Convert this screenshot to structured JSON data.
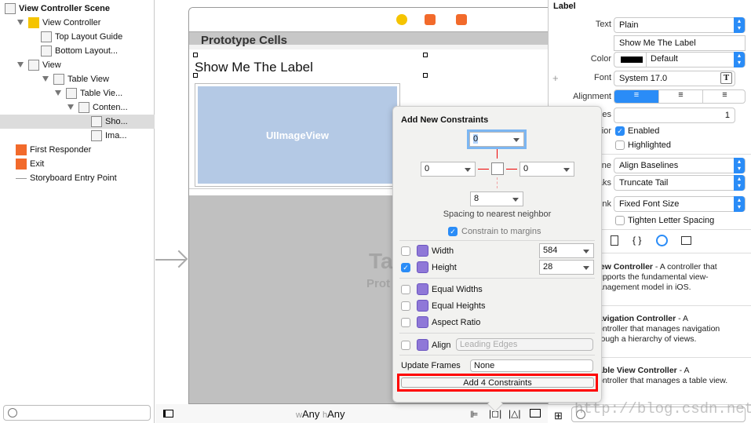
{
  "outline": {
    "items": [
      {
        "label": "View Controller Scene",
        "bold": true,
        "icon": "scene-icon"
      },
      {
        "label": "View Controller",
        "icon": "view-controller-icon"
      },
      {
        "label": "Top Layout Guide",
        "icon": "top-layout-guide-icon"
      },
      {
        "label": "Bottom Layout...",
        "icon": "bottom-layout-guide-icon"
      },
      {
        "label": "View",
        "icon": "view-icon"
      },
      {
        "label": "Table View",
        "icon": "table-view-icon"
      },
      {
        "label": "Table Vie...",
        "icon": "table-view-cell-icon"
      },
      {
        "label": "Conten...",
        "icon": "content-view-icon"
      },
      {
        "label": "Sho...",
        "icon": "label-icon",
        "selected": true
      },
      {
        "label": "Ima...",
        "icon": "image-view-icon"
      },
      {
        "label": "First Responder",
        "icon": "first-responder-icon"
      },
      {
        "label": "Exit",
        "icon": "exit-icon"
      },
      {
        "label": "Storyboard Entry Point",
        "icon": "arrow-right-icon"
      }
    ]
  },
  "canvas": {
    "prototype_cells": "Prototype Cells",
    "label_text": "Show Me The Label",
    "image_view": "UIImageView",
    "table_title_partial": "Ta",
    "table_sub_partial": "Prot",
    "size_w_prefix": "w",
    "size_w": "Any",
    "size_h_prefix": "h",
    "size_h": "Any"
  },
  "popover": {
    "title": "Add New Constraints",
    "top": "0",
    "left": "0",
    "right": "0",
    "bottom": "8",
    "spacing_label": "Spacing to nearest neighbor",
    "constrain_margins": "Constrain to margins",
    "width_label": "Width",
    "width_value": "584",
    "width_checked": false,
    "height_label": "Height",
    "height_value": "28",
    "height_checked": true,
    "equal_widths": "Equal Widths",
    "equal_heights": "Equal Heights",
    "aspect_ratio": "Aspect Ratio",
    "align_label": "Align",
    "align_value": "Leading Edges",
    "update_frames_label": "Update Frames",
    "update_frames_value": "None",
    "add_button": "Add 4 Constraints",
    "highlight_color": "#ff0000"
  },
  "inspector": {
    "section": "Label",
    "text_label": "Text",
    "text_value": "Plain",
    "text_content": "Show Me The Label",
    "color_label": "Color",
    "color_value": "Default",
    "font_label": "Font",
    "font_value": "System 17.0",
    "alignment_label": "Alignment",
    "lines_label": "es",
    "lines_value": "1",
    "behavior_label": "ior",
    "enabled": "Enabled",
    "highlighted": "Highlighted",
    "baseline_label": "ne",
    "baseline_value": "Align Baselines",
    "linebreaks_label": "aks",
    "linebreaks_value": "Truncate Tail",
    "autoshrink_label": "ink",
    "autoshrink_value": "Fixed Font Size",
    "tighten": "Tighten Letter Spacing",
    "library": [
      {
        "title": "iew Controller",
        "desc": " - A controller that",
        "line2": "upports the fundamental view-",
        "line3": "anagement model in iOS."
      },
      {
        "title": "avigation Controller",
        "desc": " - A",
        "line2": "ontroller that manages navigation",
        "line3": "rough a hierarchy of views."
      },
      {
        "title": "able View Controller",
        "desc": " - A",
        "line2": "ontroller that manages a table view.",
        "line3": ""
      }
    ],
    "watermark": "http://blog.csdn.net/"
  }
}
